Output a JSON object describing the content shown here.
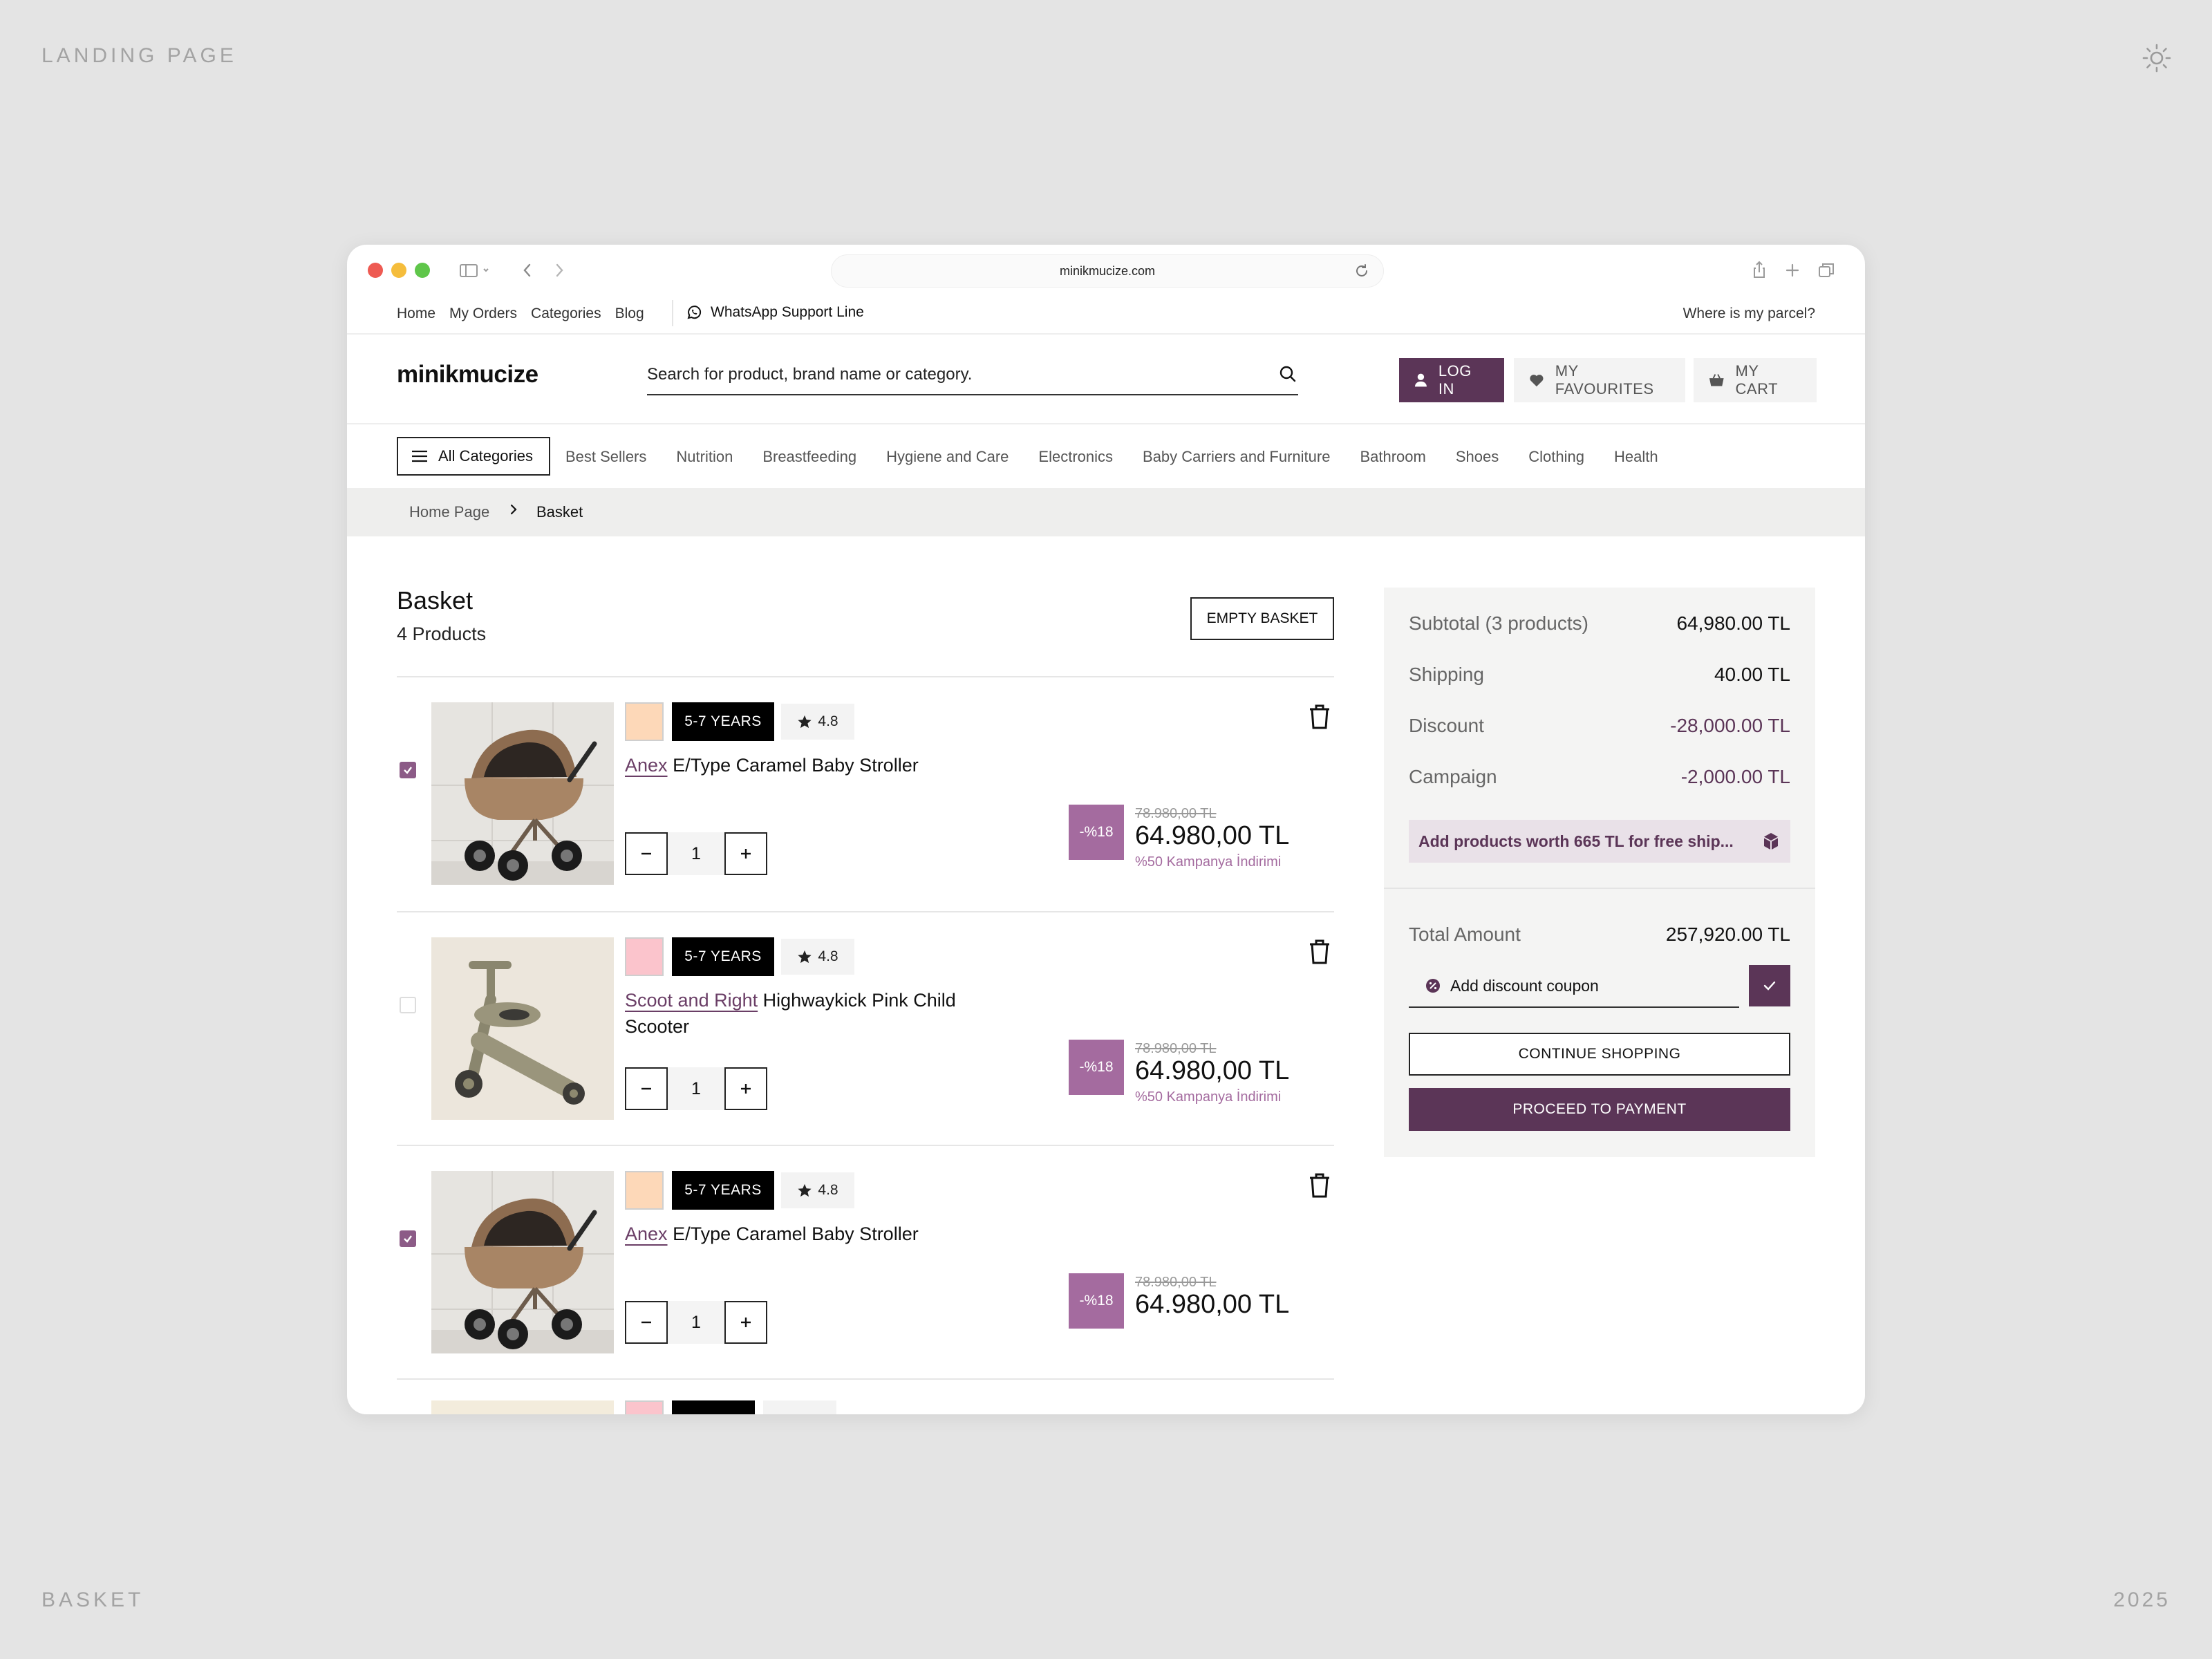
{
  "frame": {
    "top_left_label": "LANDING PAGE",
    "bottom_left_label": "BASKET",
    "bottom_right_label": "2025"
  },
  "browser": {
    "url": "minikmucize.com"
  },
  "top_links": {
    "items": [
      "Home",
      "My Orders",
      "Categories",
      "Blog"
    ],
    "whatsapp": "WhatsApp Support Line",
    "parcel": "Where is my parcel?"
  },
  "header": {
    "logo": "minikmucize",
    "search_placeholder": "Search for product, brand name or category.",
    "login": "LOG IN",
    "favourites": "MY FAVOURITES",
    "cart": "MY CART"
  },
  "categories": {
    "all_label": "All Categories",
    "items": [
      "Best Sellers",
      "Nutrition",
      "Breastfeeding",
      "Hygiene and Care",
      "Electronics",
      "Baby Carriers and Furniture",
      "Bathroom",
      "Shoes",
      "Clothing",
      "Health"
    ]
  },
  "breadcrumb": {
    "home": "Home Page",
    "current": "Basket"
  },
  "basket": {
    "title": "Basket",
    "count": "4 Products",
    "empty_button": "EMPTY BASKET",
    "items": [
      {
        "checked": true,
        "swatch_color": "#fdd8b8",
        "age": "5-7 YEARS",
        "rating": "4.8",
        "brand": "Anex",
        "name": "E/Type Caramel Baby Stroller",
        "qty": "1",
        "discount": "-%18",
        "old_price": "78.980,00 TL",
        "price": "64.980,00 TL",
        "promo": "%50 Kampanya İndirimi",
        "image_icon": "stroller-image"
      },
      {
        "checked": false,
        "swatch_color": "#fbc4cc",
        "age": "5-7 YEARS",
        "rating": "4.8",
        "brand": "Scoot and Right",
        "name": "Highwaykick Pink Child Scooter",
        "qty": "1",
        "discount": "-%18",
        "old_price": "78.980,00 TL",
        "price": "64.980,00 TL",
        "promo": "%50 Kampanya İndirimi",
        "image_icon": "scooter-image"
      },
      {
        "checked": true,
        "swatch_color": "#fdd8b8",
        "age": "5-7 YEARS",
        "rating": "4.8",
        "brand": "Anex",
        "name": "E/Type Caramel Baby Stroller",
        "qty": "1",
        "discount": "-%18",
        "old_price": "78.980,00 TL",
        "price": "64.980,00 TL",
        "promo": "",
        "image_icon": "stroller-image"
      }
    ]
  },
  "summary": {
    "subtotal_label": "Subtotal (3 products)",
    "subtotal": "64,980.00 TL",
    "shipping_label": "Shipping",
    "shipping": "40.00 TL",
    "discount_label": "Discount",
    "discount": "-28,000.00 TL",
    "campaign_label": "Campaign",
    "campaign": "-2,000.00 TL",
    "free_shipping_note": "Add products worth 665 TL for free ship...",
    "total_label": "Total Amount",
    "total": "257,920.00 TL",
    "coupon_placeholder": "Add discount coupon",
    "continue_button": "CONTINUE SHOPPING",
    "pay_button": "PROCEED TO PAYMENT"
  },
  "colors": {
    "brand_plum": "#5b3557",
    "discount_badge": "#a46b9f",
    "frame_bg": "#e4e4e4"
  }
}
